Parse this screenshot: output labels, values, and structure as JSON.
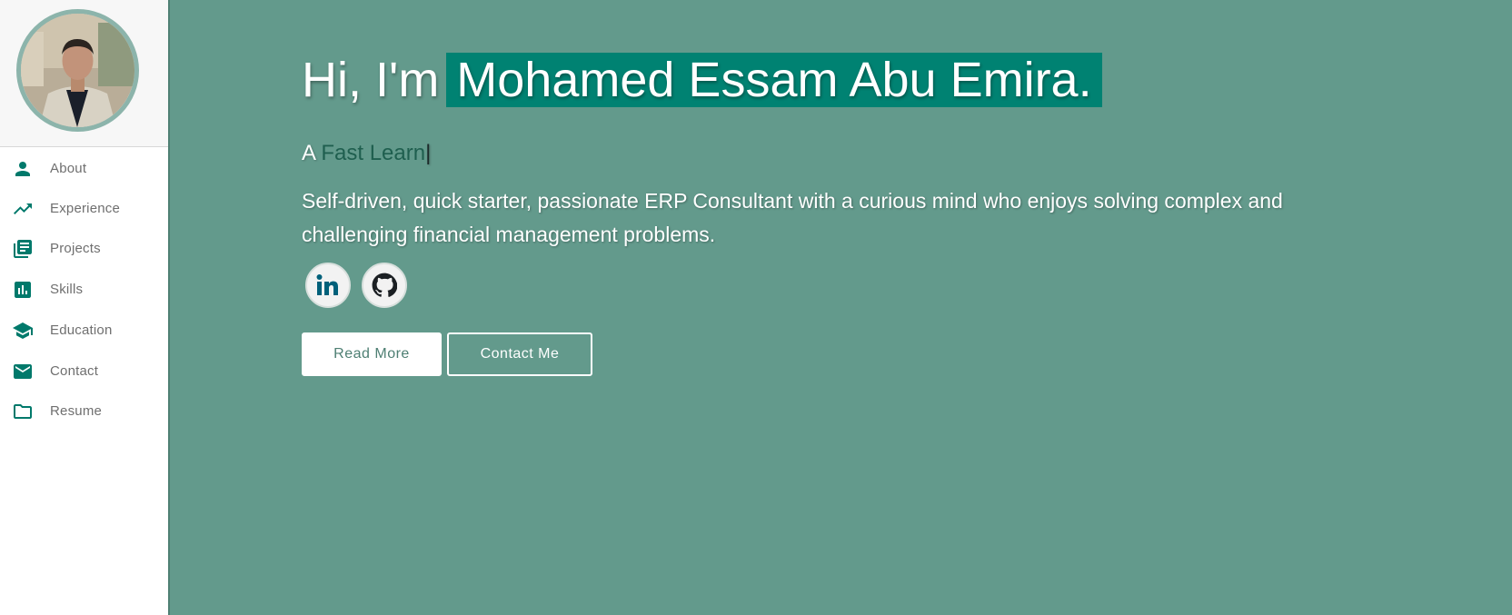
{
  "sidebar": {
    "items": [
      {
        "label": "About",
        "icon": "person-icon"
      },
      {
        "label": "Experience",
        "icon": "trending-up-icon"
      },
      {
        "label": "Projects",
        "icon": "library-books-icon"
      },
      {
        "label": "Skills",
        "icon": "bar-chart-icon"
      },
      {
        "label": "Education",
        "icon": "school-icon"
      },
      {
        "label": "Contact",
        "icon": "mail-icon"
      },
      {
        "label": "Resume",
        "icon": "folder-icon"
      }
    ]
  },
  "hero": {
    "greeting": "Hi, I'm",
    "name": "Mohamed Essam Abu Emira.",
    "tagline_prefix": "A",
    "tagline_role": "Fast Learn",
    "tagline_cursor": "|",
    "description": "Self-driven, quick starter, passionate ERP Consultant with a curious mind who enjoys solving complex and challenging financial management problems.",
    "social": [
      {
        "name": "LinkedIn",
        "icon": "linkedin-icon"
      },
      {
        "name": "GitHub",
        "icon": "github-icon"
      }
    ],
    "read_more_label": "Read More",
    "contact_me_label": "Contact Me"
  },
  "colors": {
    "accent": "#00796b",
    "main_bg": "#639a8c",
    "name_highlight": "#008272",
    "avatar_ring": "#8cb4ab"
  }
}
